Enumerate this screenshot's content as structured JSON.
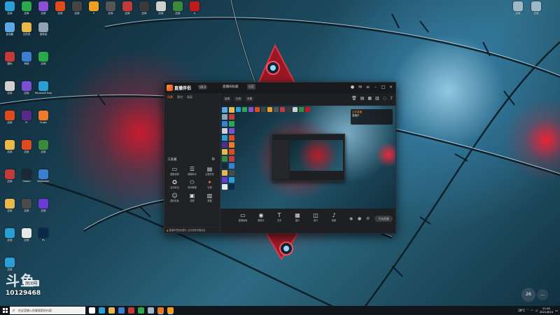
{
  "desktop": {
    "icons": [
      {
        "label": "此电脑",
        "color": "#5aa9e6"
      },
      {
        "label": "文件夹",
        "color": "#e8b84a"
      },
      {
        "label": "回收站",
        "color": "#8fa3b3"
      },
      {
        "label": "图标",
        "color": "#c23a3a"
      },
      {
        "label": "网络",
        "color": "#3c7fd1"
      },
      {
        "label": "应用",
        "color": "#2aa84a"
      },
      {
        "label": "应用",
        "color": "#d0d0d0"
      },
      {
        "label": "应用",
        "color": "#7a4fd6"
      },
      {
        "label": "Microsoft Edge",
        "color": "#2a9fd6"
      },
      {
        "label": "应用",
        "color": "#e04a1c"
      },
      {
        "label": "Pr",
        "color": "#5a2a8a"
      },
      {
        "label": "Origin",
        "color": "#f07a2a"
      },
      {
        "label": "应用",
        "color": "#e8b84a"
      },
      {
        "label": "应用",
        "color": "#e04a1c"
      },
      {
        "label": "应用",
        "color": "#3a8a3a"
      },
      {
        "label": "应用",
        "color": "#c23a3a"
      },
      {
        "label": "Steam",
        "color": "#1b2838"
      },
      {
        "label": "Wallpaper",
        "color": "#3c7fd1"
      },
      {
        "label": "应用",
        "color": "#e8b84a"
      },
      {
        "label": "应用",
        "color": "#4a4a4a"
      },
      {
        "label": "应用",
        "color": "#6a3ad6"
      },
      {
        "label": "应用",
        "color": "#2a9fd6"
      },
      {
        "label": "应用",
        "color": "#e8e8e8"
      },
      {
        "label": "Ps",
        "color": "#0b2a4a"
      },
      {
        "label": "应用",
        "color": "#2a9fd6"
      }
    ],
    "top_icons": [
      {
        "label": "应用",
        "color": "#2a9fd6"
      },
      {
        "label": "应用",
        "color": "#2aa84a"
      },
      {
        "label": "应用",
        "color": "#8a4fd6"
      },
      {
        "label": "应用",
        "color": "#e04a1c"
      },
      {
        "label": "应用",
        "color": "#444"
      },
      {
        "label": "V",
        "color": "#f0a020"
      },
      {
        "label": "应用",
        "color": "#555"
      },
      {
        "label": "应用",
        "color": "#c23a3a"
      },
      {
        "label": "应用",
        "color": "#3a3a3a"
      },
      {
        "label": "应用",
        "color": "#d0d0d0"
      },
      {
        "label": "应用",
        "color": "#3a8a3a"
      },
      {
        "label": "A",
        "color": "#c21a1a"
      }
    ],
    "right_icons": [
      {
        "label": "应用",
        "color": "#9fb8c8"
      },
      {
        "label": "应用",
        "color": "#9fb8c8"
      }
    ]
  },
  "watermark": {
    "logo": "斗鱼",
    "badge": "房间号",
    "number": "10129468"
  },
  "app": {
    "title": "直播伴侣",
    "version": "V6.0",
    "room_title": "直播间标题",
    "room_tag": "分区",
    "room_link": "",
    "left_tabs": [
      "场景",
      "素材",
      "画面"
    ],
    "active_left_tab": 0,
    "tools_header": "工具箱",
    "tools": [
      {
        "label": "直播设置",
        "icon": "▭"
      },
      {
        "label": "弹幕助手",
        "icon": "☰"
      },
      {
        "label": "主播任务",
        "icon": "▤"
      },
      {
        "label": "互动玩法",
        "icon": "✪"
      },
      {
        "label": "房间管理",
        "icon": "⚇"
      },
      {
        "label": "礼物",
        "icon": "✦"
      },
      {
        "label": "虚拟形象",
        "icon": "☺"
      },
      {
        "label": "录屏",
        "icon": "▣"
      },
      {
        "label": "数据",
        "icon": "▥"
      }
    ],
    "bottom_notice": "直播环境检测提示",
    "bottom_tip": "点击查看详细信息",
    "toolbar_chips": [
      "高清",
      "比例",
      "设置"
    ],
    "preview_popup": {
      "line1": "正在直播",
      "line2": "直播中"
    },
    "controls": [
      {
        "label": "直播画面",
        "icon": "▭"
      },
      {
        "label": "摄像头",
        "icon": "◉"
      },
      {
        "label": "文本",
        "icon": "T"
      },
      {
        "label": "图片",
        "icon": "▦"
      },
      {
        "label": "窗口",
        "icon": "◫"
      },
      {
        "label": "音频",
        "icon": "♪"
      }
    ],
    "start_live": "开始直播"
  },
  "taskbar": {
    "search_placeholder": "在这里输入你要搜索的内容",
    "time": "21:00",
    "date": "2021/8/24",
    "weather": "28°C",
    "icons": [
      {
        "name": "task-view",
        "color": "#ffffff"
      },
      {
        "name": "edge",
        "color": "#2a9fd6"
      },
      {
        "name": "folder",
        "color": "#e8b84a"
      },
      {
        "name": "store",
        "color": "#3c7fd1"
      },
      {
        "name": "app",
        "color": "#c23a3a"
      },
      {
        "name": "chrome",
        "color": "#2aa84a"
      },
      {
        "name": "app",
        "color": "#9fb8c8"
      },
      {
        "name": "app-active",
        "color": "#e07a2a"
      },
      {
        "name": "app-active",
        "color": "#f0a020"
      }
    ]
  },
  "corner_buttons": {
    "left": "26",
    "right": "…"
  }
}
